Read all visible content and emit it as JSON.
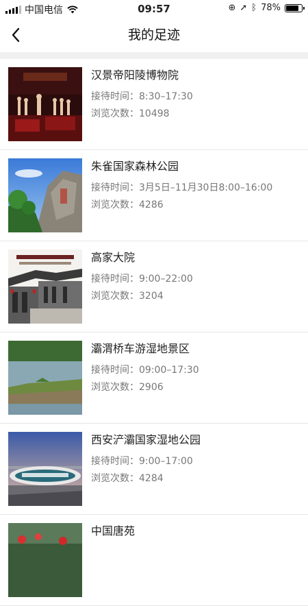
{
  "status_bar": {
    "carrier": "中国电信",
    "time": "09:57",
    "battery": "78%",
    "battery_level": 0.78,
    "icons": [
      "signal-icon",
      "wifi-icon",
      "lock-rotation-icon",
      "location-arrow-icon",
      "bluetooth-icon",
      "battery-icon"
    ]
  },
  "nav": {
    "title": "我的足迹",
    "back_icon": "chevron-left-icon"
  },
  "items": [
    {
      "title": "汉景帝阳陵博物院",
      "reception_label": "接待时间：",
      "reception": "8:30–17:30",
      "views_label": "浏览次数：",
      "views": "10498",
      "thumb_icon": "museum-photo"
    },
    {
      "title": "朱雀国家森林公园",
      "reception_label": "接待时间：",
      "reception": "3月5日–11月30日8:00–16:00",
      "views_label": "浏览次数：",
      "views": "4286",
      "thumb_icon": "forest-rock-photo"
    },
    {
      "title": "高家大院",
      "reception_label": "接待时间：",
      "reception": "9:00–22:00",
      "views_label": "浏览次数：",
      "views": "3204",
      "thumb_icon": "courtyard-photo"
    },
    {
      "title": "灞渭桥车游湿地景区",
      "reception_label": "接待时间：",
      "reception": "09:00–17:30",
      "views_label": "浏览次数：",
      "views": "2906",
      "thumb_icon": "wetland-photo"
    },
    {
      "title": "西安浐灞国家湿地公园",
      "reception_label": "接待时间：",
      "reception": "9:00–17:00",
      "views_label": "浏览次数：",
      "views": "4284",
      "thumb_icon": "park-sign-photo"
    },
    {
      "title": "中国唐苑",
      "reception_label": "",
      "reception": "",
      "views_label": "",
      "views": "",
      "thumb_icon": "garden-photo"
    }
  ]
}
